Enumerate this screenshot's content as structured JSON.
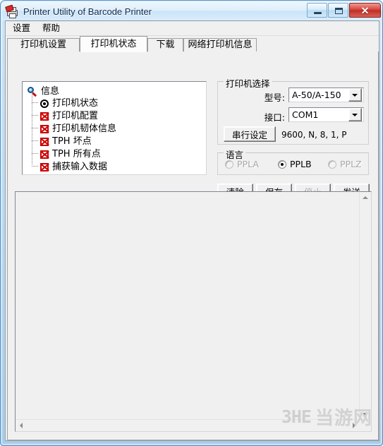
{
  "window": {
    "title": "Printer Utility of Barcode Printer",
    "icon": "printer-icon",
    "minimize_label": "─",
    "maximize_label": "□",
    "close_label": "✕"
  },
  "menubar": {
    "items": [
      {
        "label": "设置"
      },
      {
        "label": "帮助"
      }
    ]
  },
  "tabs": [
    {
      "label": "打印机设置",
      "active": false
    },
    {
      "label": "打印机状态",
      "active": true
    },
    {
      "label": "下载",
      "active": false
    },
    {
      "label": "网络打印机信息",
      "active": false
    }
  ],
  "tree": {
    "root": {
      "label": "信息",
      "icon": "magnifier-icon"
    },
    "items": [
      {
        "label": "打印机状态",
        "icon": "target-icon"
      },
      {
        "label": "打印机配置",
        "icon": "red-x-box-icon"
      },
      {
        "label": "打印机韧体信息",
        "icon": "red-x-box-icon"
      },
      {
        "label": "TPH 坏点",
        "icon": "red-x-box-icon"
      },
      {
        "label": "TPH 所有点",
        "icon": "red-x-box-icon"
      },
      {
        "label": "捕获输入数据",
        "icon": "red-x-box-icon"
      }
    ]
  },
  "printer_select": {
    "title": "打印机选择",
    "model_label": "型号:",
    "model_value": "A-50/A-150",
    "interface_label": "接口:",
    "interface_value": "COM1",
    "serial_button": "串行设定",
    "serial_summary": "9600, N, 8, 1, P"
  },
  "language": {
    "title": "语言",
    "options": [
      {
        "label": "PPLA",
        "checked": false,
        "disabled": true
      },
      {
        "label": "PPLB",
        "checked": true,
        "disabled": false
      },
      {
        "label": "PPLZ",
        "checked": false,
        "disabled": true
      }
    ]
  },
  "actions": [
    {
      "label": "清除",
      "disabled": false
    },
    {
      "label": "保存",
      "disabled": false
    },
    {
      "label": "停止",
      "disabled": true
    },
    {
      "label": "发送",
      "disabled": false
    }
  ],
  "output": {
    "text": ""
  },
  "watermark": {
    "logo": "3HE",
    "text": "当游网"
  },
  "colors": {
    "titlebar_text": "#0c2a4d",
    "frame": "#5b9bd0",
    "close_button": "#bf2e24",
    "tree_error_icon": "#cc0000",
    "panel_bg": "#f0f0f0"
  }
}
